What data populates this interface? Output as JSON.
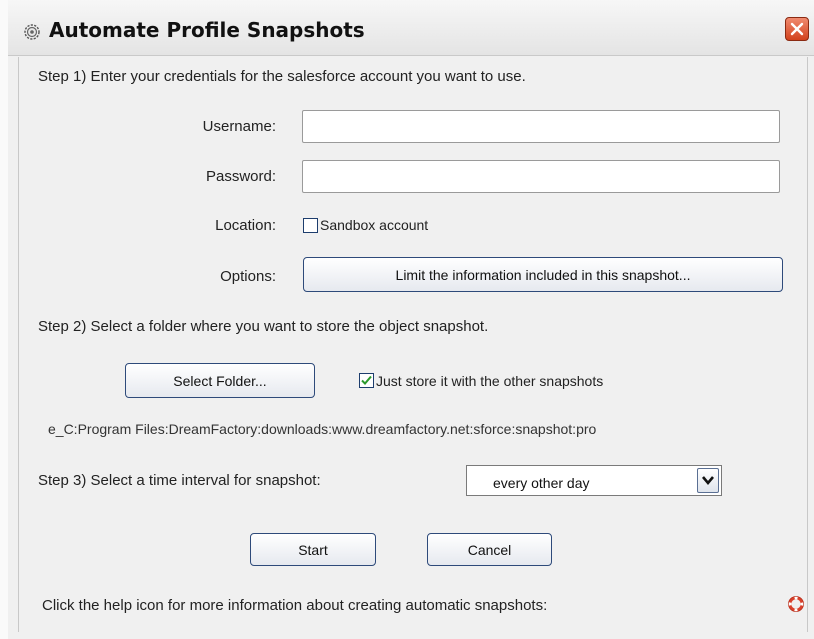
{
  "window": {
    "title": "Automate Profile Snapshots"
  },
  "step1": {
    "heading": "Step 1) Enter your credentials for the salesforce account you want to use.",
    "username_label": "Username:",
    "username_value": "",
    "password_label": "Password:",
    "password_value": "",
    "location_label": "Location:",
    "sandbox_label": "Sandbox account",
    "sandbox_checked": false,
    "options_label": "Options:",
    "options_button": "Limit the information included in this snapshot..."
  },
  "step2": {
    "heading": "Step 2) Select a folder where you want to store the object snapshot.",
    "select_folder_button": "Select Folder...",
    "store_with_others_label": "Just store it with the other snapshots",
    "store_with_others_checked": true,
    "path": "е_C:Program Files:DreamFactory:downloads:www.dreamfactory.net:sforce:snapshot:pro"
  },
  "step3": {
    "heading": "Step 3) Select a time interval for snapshot:",
    "interval_selected": "every other day"
  },
  "actions": {
    "start_button": "Start",
    "cancel_button": "Cancel"
  },
  "footer": {
    "help_text": "Click the help icon for more information about creating automatic snapshots:"
  },
  "colors": {
    "window_bg": "#f0f0f0",
    "button_border": "#2e4a7a",
    "close_button": "#d2421d",
    "checkmark": "#2c9a2c",
    "help_icon": "#d9402a"
  },
  "icons": {
    "title": "gear-icon",
    "close": "close-icon",
    "help": "help-lifebuoy-icon",
    "dropdown": "chevron-down-icon",
    "check": "checkmark-icon"
  }
}
